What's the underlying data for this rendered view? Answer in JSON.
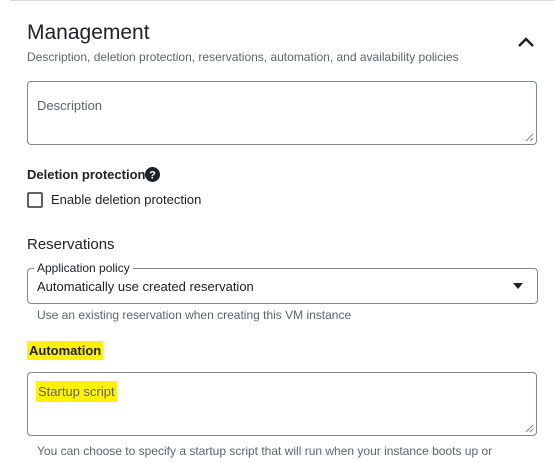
{
  "section": {
    "title": "Management",
    "subtitle": "Description, deletion protection, reservations, automation, and availability policies",
    "collapse_icon": "chevron-up-icon"
  },
  "description": {
    "placeholder": "Description"
  },
  "deletion_protection": {
    "label": "Deletion protection",
    "help_icon": "help-circle-icon",
    "checkbox_label": "Enable deletion protection",
    "checked": false
  },
  "reservations": {
    "heading": "Reservations",
    "policy_label": "Application policy",
    "policy_value": "Automatically use created reservation",
    "hint": "Use an existing reservation when creating this VM instance"
  },
  "automation": {
    "label": "Automation",
    "startup_placeholder": "Startup script",
    "help_text": "You can choose to specify a startup script that will run when your instance boots up or"
  },
  "colors": {
    "highlight": "#fff200",
    "border": "#80868b",
    "secondary_text": "#5f6368"
  }
}
